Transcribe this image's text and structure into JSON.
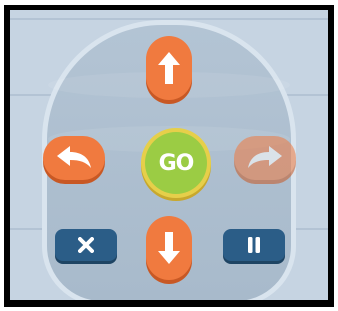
{
  "controls": {
    "center": {
      "label": "GO",
      "color": "#9bcc44",
      "ring_color": "#e6cf4a"
    },
    "up": {
      "icon": "arrow-up-icon",
      "color": "#f07a3f",
      "enabled": true
    },
    "down": {
      "icon": "arrow-down-icon",
      "color": "#f07a3f",
      "enabled": true
    },
    "turn_left": {
      "icon": "turn-left-icon",
      "color": "#f07a3f",
      "enabled": true
    },
    "turn_right": {
      "icon": "turn-right-icon",
      "color": "#f07a3f",
      "enabled": false
    },
    "cancel": {
      "icon": "close-icon",
      "color": "#2b5d87"
    },
    "pause": {
      "icon": "pause-icon",
      "color": "#2b5d87"
    }
  }
}
